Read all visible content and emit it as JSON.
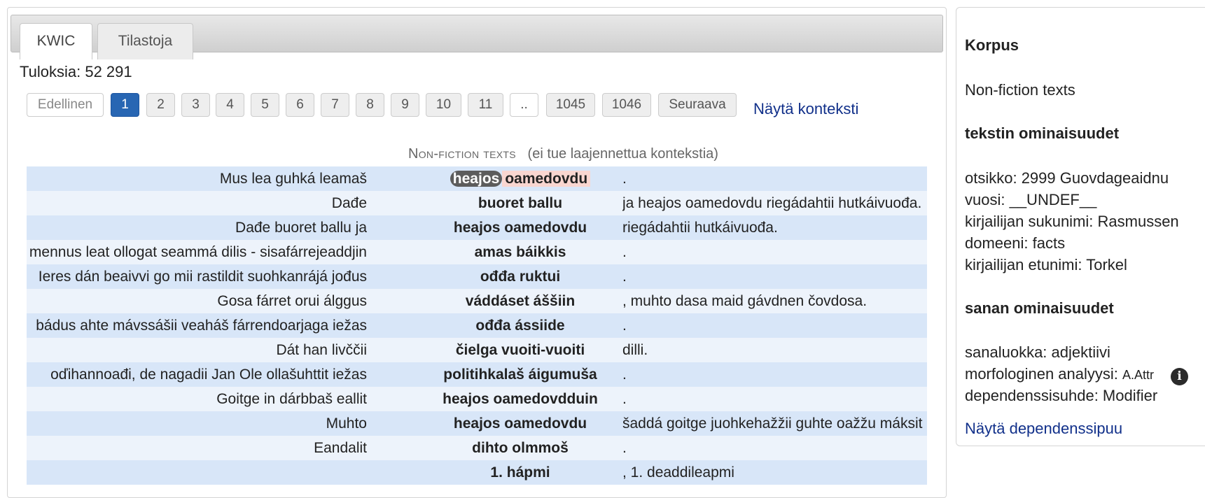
{
  "tabs": {
    "kwic": "KWIC",
    "stats": "Tilastoja"
  },
  "results": {
    "label": "Tuloksia: 52 291"
  },
  "pager": {
    "prev": "Edellinen",
    "pages": [
      "1",
      "2",
      "3",
      "4",
      "5",
      "6",
      "7",
      "8",
      "9",
      "10",
      "11",
      "..",
      "1045",
      "1046"
    ],
    "current": "1",
    "next": "Seuraava"
  },
  "context_link": "Näytä konteksti",
  "corpus_header": {
    "name": "Non-fiction texts",
    "note": "(ei tue laajennettua kontekstia)"
  },
  "rows": [
    {
      "left": "Mus lea guhká leamaš",
      "match_a": "heajos",
      "match_b": "oamedovdu",
      "right": "."
    },
    {
      "left": "Dađe",
      "match": "buoret ballu",
      "right": "ja heajos oamedovdu riegádahtii hutkáivuođa."
    },
    {
      "left": "Dađe buoret ballu ja",
      "match": "heajos oamedovdu",
      "right": "riegádahtii hutkáivuođa."
    },
    {
      "left": "mennus leat ollogat seammá dilis - sisafárrejeaddjin",
      "match": "amas báikkis",
      "right": "."
    },
    {
      "left": "Ieres dán beaivvi go mii rastildit suohkanrájá jođus",
      "match": "ođđa ruktui",
      "right": "."
    },
    {
      "left": "Gosa fárret orui álggus",
      "match": "váddáset áššiin",
      "right": ", muhto dasa maid gávdnen čovdosa."
    },
    {
      "left": "bádus ahte mávssášii veaháš fárrendoarjaga iežas",
      "match": "ođđa ássiide",
      "right": "."
    },
    {
      "left": "Dát han livččii",
      "match": "čielga vuoiti-vuoiti",
      "right": "dilli."
    },
    {
      "left": "oďihannoađi, de nagadii Jan Ole ollašuhttit iežas",
      "match": "politihkalaš áigumuša",
      "right": "."
    },
    {
      "left": "Goitge in dárbbaš eallit",
      "match": "heajos oamedovdduin",
      "right": "."
    },
    {
      "left": "Muhto",
      "match": "heajos oamedovdu",
      "right": "šaddá goitge juohkehažžii guhte oažžu máksit"
    },
    {
      "left": "Eandalit",
      "match": "dihto olmmoš",
      "right": "."
    },
    {
      "left": "",
      "match": "1. hápmi",
      "right": ", 1. deaddileapmi"
    }
  ],
  "sidebar": {
    "corpus_heading": "Korpus",
    "corpus_name": "Non-fiction texts",
    "text_props_heading": "tekstin ominaisuudet",
    "text_props": [
      "otsikko: 2999 Guovdageaidnu",
      "vuosi: __UNDEF__",
      "kirjailijan sukunimi: Rasmussen",
      "domeeni: facts",
      "kirjailijan etunimi: Torkel"
    ],
    "word_props_heading": "sanan ominaisuudet",
    "word_class": "sanaluokka: adjektiivi",
    "morph_label": "morfologinen analyysi:",
    "morph_value": "A.Attr",
    "dep_rel": "dependenssisuhde: Modifier",
    "dep_tree_link": "Näytä dependenssipuu",
    "info_icon": "i"
  },
  "colors": {
    "accent": "#2866b3",
    "link": "#11308a",
    "row_odd": "#d8e6f8",
    "row_even": "#edf3fb"
  }
}
